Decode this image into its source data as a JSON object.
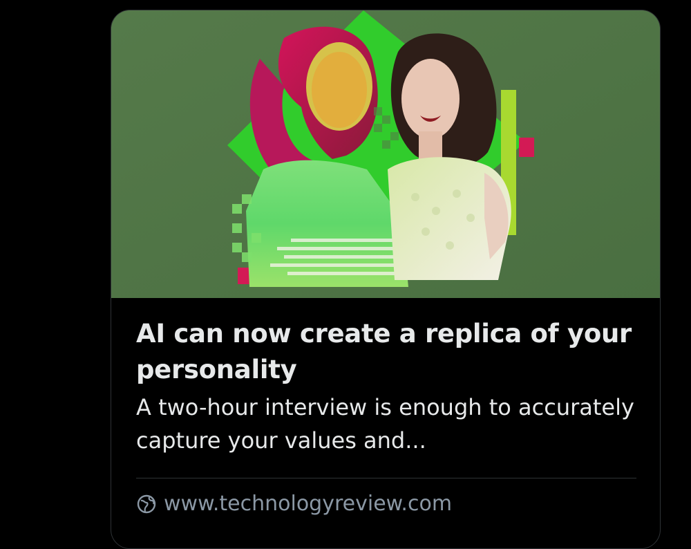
{
  "card": {
    "title": "AI can now create a replica of your personality",
    "description": "A two-hour interview is enough to accurately capture your values and...",
    "domain": "www.technologyreview.com",
    "domain_icon": "globe-link-icon"
  },
  "colors": {
    "page_background": "#000000",
    "image_background": "#4e7344",
    "title_text": "#e7e9ea",
    "domain_text": "#8b98a5",
    "accent_green": "#2fd12b",
    "accent_magenta": "#e0155a"
  }
}
